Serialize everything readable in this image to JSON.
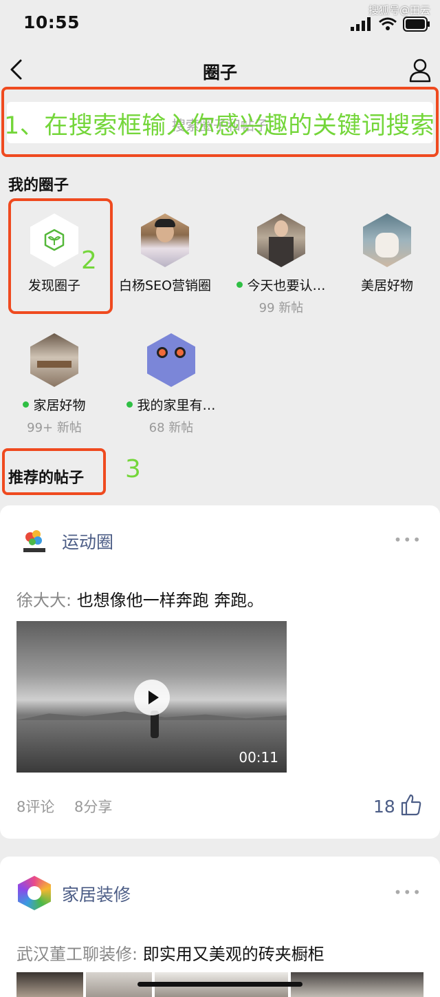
{
  "status": {
    "time": "10:55",
    "watermark": "搜狐号@田云"
  },
  "nav": {
    "title": "圈子"
  },
  "search": {
    "placeholder": "搜索圈子和帖子"
  },
  "annotations": {
    "step1": "1、在搜索框输入你感兴趣的关键词搜索",
    "step2": "2",
    "step3": "3",
    "color_box": "#ef4a1f",
    "color_text": "#74d63a"
  },
  "my_circles": {
    "title": "我的圈子",
    "items": [
      {
        "name": "发现圈子",
        "icon": "sprout-cube-icon"
      },
      {
        "name": "白杨SEO营销圈",
        "icon": "avatar"
      },
      {
        "name": "今天也要认…",
        "new": "99 新帖",
        "unread": true
      },
      {
        "name": "美居好物",
        "icon": "chair-image"
      },
      {
        "name": "家居好物",
        "new": "99+ 新帖",
        "unread": true
      },
      {
        "name": "我的家里有…",
        "new": "68 新帖",
        "unread": true
      }
    ]
  },
  "recommended": {
    "title": "推荐的帖子",
    "posts": [
      {
        "circle": "运动圈",
        "author": "徐大大:",
        "text": " 也想像他一样奔跑 奔跑。",
        "duration": "00:11",
        "comments": "8评论",
        "shares": "8分享",
        "likes": "18"
      },
      {
        "circle": "家居装修",
        "author": "武汉董工聊装修:",
        "text": " 即实用又美观的砖夹橱柜"
      }
    ]
  },
  "colors": {
    "accent_link": "#4c5d86",
    "online_dot": "#2fbf44"
  }
}
